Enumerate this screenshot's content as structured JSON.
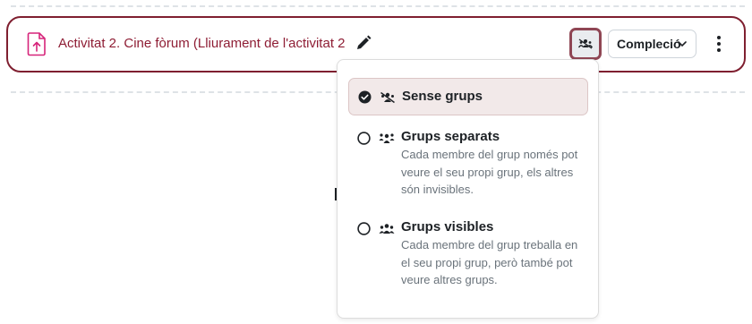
{
  "activity": {
    "title": "Activitat 2. Cine fòrum (Lliurament de l'activitat 2",
    "icon": "assignment-upload-icon",
    "edit_icon": "pencil-icon",
    "accent_color": "#8e1d34",
    "border_color": "#7f1f30"
  },
  "toolbar": {
    "groupmode_icon": "users-icon",
    "completion_label": "Compleció",
    "completion_icon": "chevron-down-icon",
    "more_icon": "kebab-vertical-icon"
  },
  "group_menu": {
    "selected_bg": "#f2e9e9",
    "options": [
      {
        "title": "Sense grups",
        "description": "",
        "selected": true,
        "icon": "no-groups-icon"
      },
      {
        "title": "Grups separats",
        "description": "Cada membre del grup només pot veure el seu propi grup, els altres són invisibles.",
        "selected": false,
        "icon": "separate-groups-icon"
      },
      {
        "title": "Grups visibles",
        "description": "Cada membre del grup treballa en el seu propi grup, però també pot veure altres grups.",
        "selected": false,
        "icon": "visible-groups-icon"
      }
    ]
  }
}
